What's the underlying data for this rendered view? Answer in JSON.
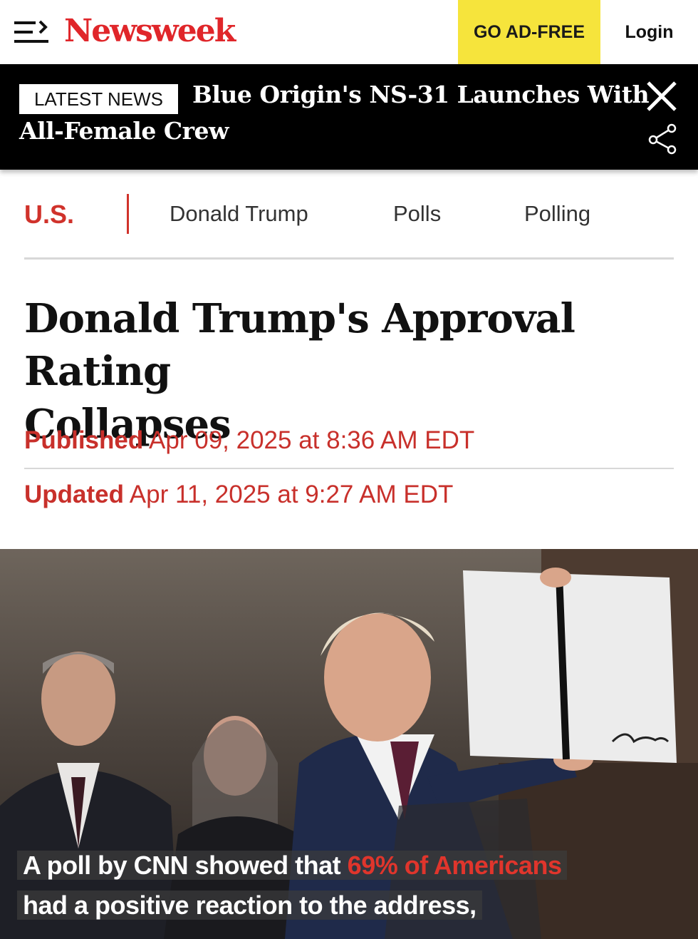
{
  "header": {
    "logo": "Newsweek",
    "ad_free_label": "GO AD-FREE",
    "login_label": "Login",
    "menu_icon": "hamburger-arrow-icon"
  },
  "banner": {
    "badge": "LATEST NEWS",
    "headline_line1": "Blue Origin's NS-31 Launches With",
    "headline_line2": "All-Female Crew",
    "close_icon": "close-icon",
    "share_icon": "share-icon"
  },
  "nav": {
    "section": "U.S.",
    "tags": [
      "Donald Trump",
      "Polls",
      "Polling"
    ]
  },
  "article": {
    "title_line1": "Donald Trump's Approval Rating",
    "title_line2": "Collapses",
    "published_label": "Published",
    "published_value": "Apr 09, 2025 at 8:36 AM EDT",
    "updated_label": "Updated",
    "updated_value": "Apr 11, 2025 at 9:27 AM EDT"
  },
  "image": {
    "caption_part1": "A poll by CNN showed that ",
    "caption_highlight": "69% of Americans",
    "caption_line2": "had a positive reaction to the address,"
  },
  "colors": {
    "brand_red": "#e0262a",
    "meta_red": "#c8302b",
    "ad_free_yellow": "#f6e43c",
    "banner_black": "#000000"
  }
}
